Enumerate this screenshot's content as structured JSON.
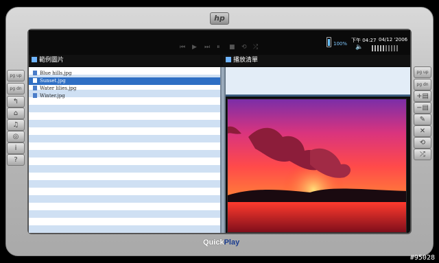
{
  "device": {
    "brand_logo": "hp",
    "footer_logo_a": "Quick",
    "footer_logo_b": "Play"
  },
  "status": {
    "battery": "100%",
    "time": "下午 04:27",
    "date": "04/12 '2006"
  },
  "left_panel": {
    "title": "範例圖片"
  },
  "right_panel": {
    "title": "播放清單"
  },
  "files": [
    {
      "name": "Blue hills.jpg",
      "selected": false
    },
    {
      "name": "Sunset.jpg",
      "selected": true
    },
    {
      "name": "Water lilies.jpg",
      "selected": false
    },
    {
      "name": "Winter.jpg",
      "selected": false
    }
  ],
  "left_buttons": [
    "pg up",
    "pg dn",
    "back-icon",
    "home-icon",
    "music-icon",
    "search-icon",
    "info-icon",
    "help-icon"
  ],
  "left_button_glyphs": {
    "pg_up": "pg up",
    "pg_dn": "pg dn",
    "back": "↰",
    "home": "⌂",
    "music": "♫",
    "search": "◎",
    "info": "i",
    "help": "?"
  },
  "right_button_glyphs": {
    "pg_up": "pg up",
    "pg_dn": "pg dn",
    "add": "+▤",
    "remove": "−▤",
    "edit": "✎",
    "close": "✕",
    "repeat": "⟲",
    "shuffle": "⤮"
  },
  "transport": {
    "prev": "⏮",
    "play": "▶",
    "next": "⏭",
    "pause": "⏸",
    "stop": "■",
    "repeat": "⟲",
    "shuffle": "⤮"
  },
  "volume": {
    "mute_icon": "🔈",
    "level": 0.5
  },
  "watermark": "#95028"
}
